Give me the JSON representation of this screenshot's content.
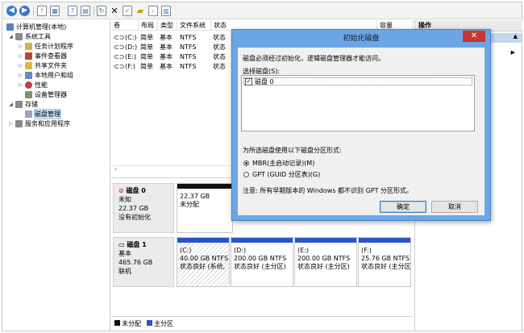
{
  "tree": {
    "root": "计算机管理(本地)",
    "system_tools": "系统工具",
    "task_scheduler": "任务计划程序",
    "event_viewer": "事件查看器",
    "shared_folders": "共享文件夹",
    "local_users": "本地用户和组",
    "performance": "性能",
    "device_manager": "设备管理器",
    "storage": "存储",
    "disk_management": "磁盘管理",
    "services_apps": "服务和应用程序"
  },
  "volume_table": {
    "headers": [
      "卷",
      "布局",
      "类型",
      "文件系统",
      "状态",
      "容量"
    ],
    "rows": [
      [
        "(C:)",
        "简单",
        "基本",
        "NTFS",
        "状态"
      ],
      [
        "(D:)",
        "简单",
        "基本",
        "NTFS",
        "状态"
      ],
      [
        "(E:)",
        "简单",
        "基本",
        "NTFS",
        "状态"
      ],
      [
        "(F:)",
        "简单",
        "基本",
        "NTFS",
        "状态"
      ]
    ]
  },
  "disk0": {
    "name": "磁盘 0",
    "type": "未知",
    "size": "22.37 GB",
    "status": "没有初始化",
    "part_size": "22.37 GB",
    "part_status": "未分配"
  },
  "disk1": {
    "name": "磁盘 1",
    "type": "基本",
    "size": "465.76 GB",
    "status": "联机",
    "partitions": [
      {
        "label": "(C:)",
        "size": "40.00 GB NTFS",
        "status": "状态良好 (系统,"
      },
      {
        "label": "(D:)",
        "size": "200.00 GB NTFS",
        "status": "状态良好 (主分区)"
      },
      {
        "label": "(E:)",
        "size": "200.00 GB NTFS",
        "status": "状态良好 (主分区)"
      },
      {
        "label": "(F:)",
        "size": "25.76 GB NTFS",
        "status": "状态良好 (主分区)"
      }
    ]
  },
  "legend": {
    "unallocated": "未分配",
    "primary": "主分区"
  },
  "ops": {
    "header": "操作"
  },
  "dialog": {
    "title": "初始化磁盘",
    "close": "✕",
    "intro": "磁盘必须经过初始化，逻辑磁盘管理器才能访问。",
    "select_label": "选择磁盘(S):",
    "disk_item": "磁盘 0",
    "style_label": "为所选磁盘使用以下磁盘分区形式:",
    "mbr": "MBR(主启动记录)(M)",
    "gpt": "GPT (GUID 分区表)(G)",
    "note": "注意: 所有早期版本的 Windows 都不识别 GPT 分区形式。",
    "ok": "确定",
    "cancel": "取消"
  },
  "colors": {
    "primary_partition": "#2b55c7",
    "unallocated": "#111111",
    "dialog_frame": "#6aa6e6",
    "close_button": "#c7372f"
  }
}
